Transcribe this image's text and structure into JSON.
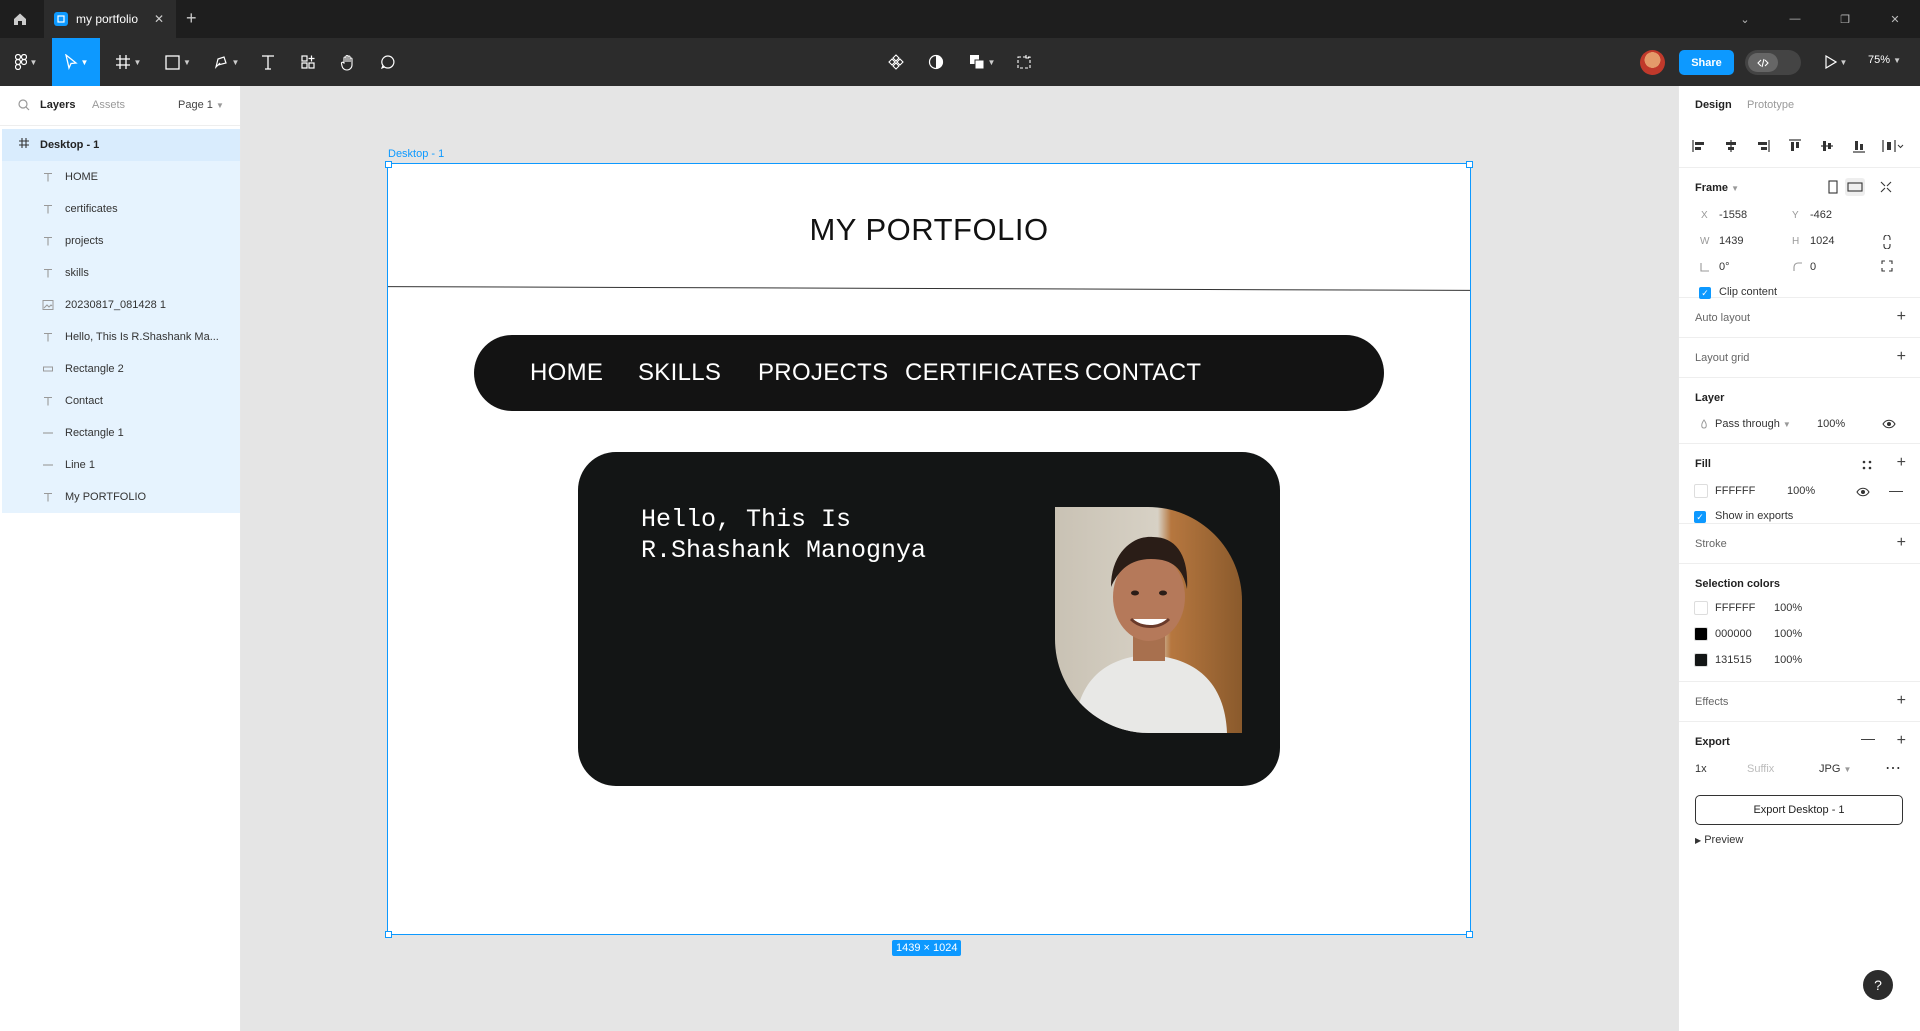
{
  "titlebar": {
    "tab_title": "my portfolio",
    "new_tab": "+"
  },
  "toolbar": {
    "share_label": "Share",
    "zoom": "75%"
  },
  "left_panel": {
    "tab_layers": "Layers",
    "tab_assets": "Assets",
    "page": "Page 1",
    "layers": [
      {
        "name": "Desktop - 1",
        "icon": "frame-icon",
        "top": true
      },
      {
        "name": "HOME",
        "icon": "text-icon"
      },
      {
        "name": "certificates",
        "icon": "text-icon"
      },
      {
        "name": "projects",
        "icon": "text-icon"
      },
      {
        "name": "skills",
        "icon": "text-icon"
      },
      {
        "name": "20230817_081428 1",
        "icon": "image-icon"
      },
      {
        "name": "Hello, This Is R.Shashank Ma...",
        "icon": "text-icon"
      },
      {
        "name": "Rectangle 2",
        "icon": "rectangle-icon"
      },
      {
        "name": "Contact",
        "icon": "text-icon"
      },
      {
        "name": "Rectangle 1",
        "icon": "line-icon"
      },
      {
        "name": "Line 1",
        "icon": "line-icon"
      },
      {
        "name": "My PORTFOLIO",
        "icon": "text-icon"
      }
    ]
  },
  "canvas": {
    "frame_label": "Desktop - 1",
    "size_badge": "1439 × 1024",
    "design": {
      "title": "MY PORTFOLIO",
      "nav": [
        "HOME",
        "SKILLS",
        "PROJECTS",
        "CERTIFICATES",
        "CONTACT"
      ],
      "hero_text": "Hello, This Is\nR.Shashank Manognya"
    }
  },
  "right_panel": {
    "tab_design": "Design",
    "tab_prototype": "Prototype",
    "frame": {
      "label": "Frame",
      "x_label": "X",
      "x": "-1558",
      "y_label": "Y",
      "y": "-462",
      "w_label": "W",
      "w": "1439",
      "h_label": "H",
      "h": "1024",
      "rotation": "0°",
      "radius": "0",
      "clip_content": "Clip content"
    },
    "auto_layout": "Auto layout",
    "layout_grid": "Layout grid",
    "layer": {
      "label": "Layer",
      "blend": "Pass through",
      "opacity": "100%"
    },
    "fill": {
      "label": "Fill",
      "hex": "FFFFFF",
      "opacity": "100%",
      "show_in_exports": "Show in exports"
    },
    "stroke": "Stroke",
    "selection_colors": {
      "label": "Selection colors",
      "items": [
        {
          "hex": "FFFFFF",
          "opacity": "100%",
          "color": "#FFFFFF"
        },
        {
          "hex": "000000",
          "opacity": "100%",
          "color": "#000000"
        },
        {
          "hex": "131515",
          "opacity": "100%",
          "color": "#131515"
        }
      ]
    },
    "effects": "Effects",
    "export": {
      "label": "Export",
      "scale": "1x",
      "suffix_placeholder": "Suffix",
      "format": "JPG",
      "button": "Export Desktop - 1",
      "preview": "Preview"
    },
    "help": "?"
  },
  "colors": {
    "accent": "#0d99ff",
    "toolbar": "#2c2c2c",
    "dark_card": "#131515"
  }
}
